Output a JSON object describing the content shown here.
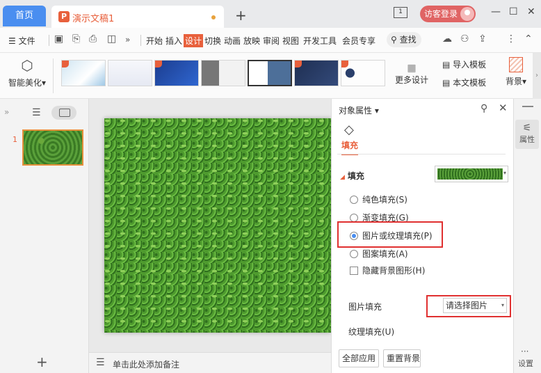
{
  "titlebar": {
    "home_tab": "首页",
    "doc_tab": "演示文稿1",
    "doc_icon": "P",
    "new_tab": "+",
    "guest_login": "访客登录",
    "window_icon_label": "1",
    "minimize": "—",
    "maximize": "☐",
    "close": "✕"
  },
  "menubar": {
    "file": "文件",
    "menu_items": [
      "开始",
      "插入",
      "设计",
      "切换",
      "动画",
      "放映",
      "审阅",
      "视图",
      "开发工具",
      "会员专享"
    ],
    "active_item": "设计",
    "search": "查找"
  },
  "ribbon": {
    "beautify": "智能美化",
    "thumb_captions": [
      "",
      "",
      "",
      "",
      "",
      "",
      ""
    ],
    "more_design": "更多设计",
    "import_template": "导入模板",
    "this_template": "本文模板",
    "background": "背景"
  },
  "slides_panel": {
    "slide_number": "1",
    "add": "+"
  },
  "notes": {
    "placeholder": "单击此处添加备注"
  },
  "properties": {
    "title": "对象属性",
    "tab_fill": "填充",
    "section_fill": "填充",
    "options": {
      "solid": "纯色填充(S)",
      "gradient": "渐变填充(G)",
      "picture": "图片或纹理填充(P)",
      "pattern": "图案填充(A)",
      "hide_bg": "隐藏背景图形(H)"
    },
    "picture_fill_label": "图片填充",
    "picture_select": "请选择图片",
    "texture_fill_label": "纹理填充(U)",
    "apply_all": "全部应用",
    "reset": "重置背景"
  },
  "right_strip": {
    "attributes": "属性",
    "settings": "设置",
    "more": "···"
  },
  "colors": {
    "accent": "#e8603c",
    "home_tab": "#4a8ef0",
    "highlight_box": "#e03030"
  }
}
